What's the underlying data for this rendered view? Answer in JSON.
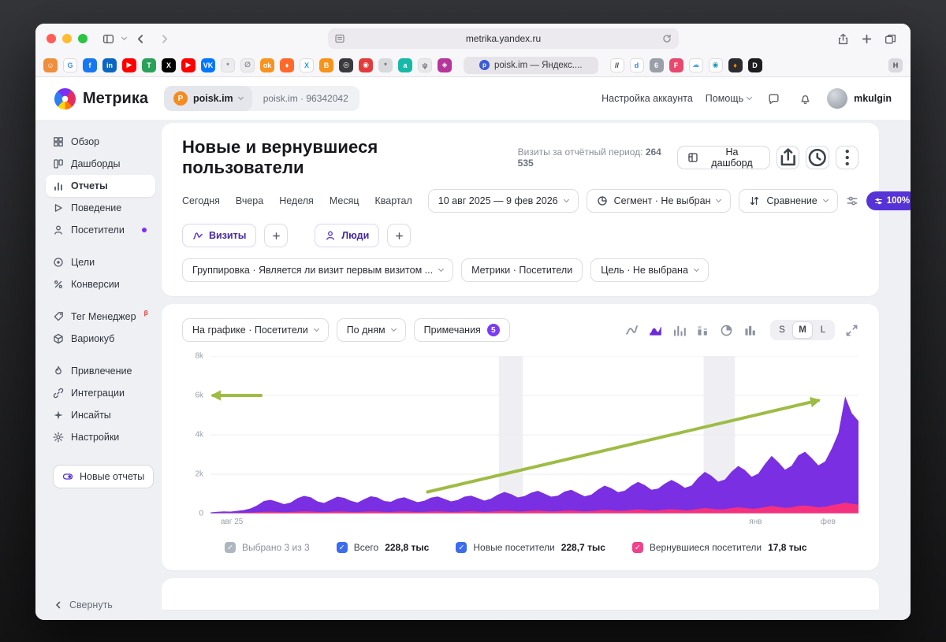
{
  "browser": {
    "url": "metrika.yandex.ru",
    "tab_title": "poisk.im — Яндекс....",
    "tab_favicon": "p",
    "bookmarks_left": [
      {
        "glyph": "☺",
        "bg": "#ef8e3b",
        "fg": "#ffffff"
      },
      {
        "glyph": "G",
        "bg": "#ffffff",
        "fg": "#4285f4",
        "border": true
      },
      {
        "glyph": "f",
        "bg": "#1877f2",
        "fg": "#ffffff"
      },
      {
        "glyph": "in",
        "bg": "#0a66c2",
        "fg": "#ffffff"
      },
      {
        "glyph": "▶",
        "bg": "#ff0000",
        "fg": "#ffffff"
      },
      {
        "glyph": "T",
        "bg": "#2aa159",
        "fg": "#ffffff"
      },
      {
        "glyph": "X",
        "bg": "#000000",
        "fg": "#ffffff"
      },
      {
        "glyph": "▶",
        "bg": "#ff0000",
        "fg": "#ffffff"
      },
      {
        "glyph": "VK",
        "bg": "#0077ff",
        "fg": "#ffffff"
      },
      {
        "glyph": "*",
        "bg": "#ececee",
        "fg": "#7b7b82",
        "border": true
      },
      {
        "glyph": "∅",
        "bg": "#ececee",
        "fg": "#7b7b82",
        "border": true
      },
      {
        "glyph": "ok",
        "bg": "#f7931e",
        "fg": "#ffffff"
      },
      {
        "glyph": "♦",
        "bg": "#ff6a2b",
        "fg": "#ffffff"
      },
      {
        "glyph": "X",
        "bg": "#ffffff",
        "fg": "#1d9bf0",
        "border": true
      },
      {
        "glyph": "B",
        "bg": "#f7931a",
        "fg": "#ffffff"
      },
      {
        "glyph": "◎",
        "bg": "#3a3a3e",
        "fg": "#ffffff"
      },
      {
        "glyph": "◉",
        "bg": "#e23b3b",
        "fg": "#ffffff"
      },
      {
        "glyph": "*",
        "bg": "#d7d9dd",
        "fg": "#606067"
      },
      {
        "glyph": "a",
        "bg": "#16b8a8",
        "fg": "#ffffff"
      },
      {
        "glyph": "ψ",
        "bg": "#e9e9ec",
        "fg": "#6a6a72",
        "border": true
      },
      {
        "glyph": "◈",
        "bg": "#b5359b",
        "fg": "#ffffff"
      }
    ],
    "bookmarks_right": [
      {
        "glyph": "//",
        "bg": "#ffffff",
        "fg": "#2b2b30",
        "border": true
      },
      {
        "glyph": "d",
        "bg": "#ffffff",
        "fg": "#2f7cf6",
        "border": true
      },
      {
        "glyph": "6",
        "bg": "#9a9fa8",
        "fg": "#ffffff"
      },
      {
        "glyph": "F",
        "bg": "#e8486e",
        "fg": "#ffffff"
      },
      {
        "glyph": "☁",
        "bg": "#ffffff",
        "fg": "#4aa3f5",
        "border": true
      },
      {
        "glyph": "◉",
        "bg": "#ffffff",
        "fg": "#189ab0",
        "border": true
      },
      {
        "glyph": "♦",
        "bg": "#2b2b30",
        "fg": "#ff8a00"
      },
      {
        "glyph": "D",
        "bg": "#1d1d20",
        "fg": "#ffffff"
      }
    ],
    "bookmarks_far_right": [
      {
        "glyph": "H",
        "bg": "#d9d9de",
        "fg": "#4a4a50"
      }
    ]
  },
  "header": {
    "brand": "Метрика",
    "counter_badge": "P",
    "counter_name": "poisk.im",
    "counter_meta": "poisk.im  ·  96342042",
    "account": "Настройка аккаунта",
    "help": "Помощь",
    "user": "mkulgin"
  },
  "sidebar": {
    "groups": [
      {
        "items": [
          {
            "key": "overview",
            "label": "Обзор",
            "icon": "grid"
          },
          {
            "key": "dashboards",
            "label": "Дашборды",
            "icon": "dashboards"
          },
          {
            "key": "reports",
            "label": "Отчеты",
            "icon": "reports",
            "active": true
          },
          {
            "key": "behavior",
            "label": "Поведение",
            "icon": "behavior"
          },
          {
            "key": "visitors",
            "label": "Посетители",
            "icon": "person",
            "dot": true
          }
        ]
      },
      {
        "items": [
          {
            "key": "goals",
            "label": "Цели",
            "icon": "goals"
          },
          {
            "key": "conversions",
            "label": "Конверсии",
            "icon": "conversions"
          }
        ]
      },
      {
        "items": [
          {
            "key": "tag-manager",
            "label": "Тег Менеджер",
            "icon": "tag",
            "badge": "β"
          },
          {
            "key": "variocube",
            "label": "Вариокуб",
            "icon": "cube"
          }
        ]
      },
      {
        "items": [
          {
            "key": "acquisition",
            "label": "Привлечение",
            "icon": "flame"
          },
          {
            "key": "integrations",
            "label": "Интеграции",
            "icon": "integrations"
          },
          {
            "key": "insights",
            "label": "Инсайты",
            "icon": "insights"
          },
          {
            "key": "settings",
            "label": "Настройки",
            "icon": "settings"
          }
        ]
      }
    ],
    "new_reports": "Новые отчеты",
    "collapse": "Свернуть"
  },
  "report": {
    "title": "Новые и вернувшиеся пользователи",
    "visits_label": "Визиты за отчётный период:",
    "visits_value": "264 535",
    "to_dashboard": "На дашборд",
    "periods": [
      {
        "key": "today",
        "label": "Сегодня"
      },
      {
        "key": "yesterday",
        "label": "Вчера"
      },
      {
        "key": "week",
        "label": "Неделя"
      },
      {
        "key": "month",
        "label": "Месяц"
      },
      {
        "key": "quarter",
        "label": "Квартал"
      }
    ],
    "date_range": "10 авг 2025 — 9 фев 2026",
    "segment": "Сегмент · Не выбран",
    "compare": "Сравнение",
    "sampling": "100%",
    "chip_visits": "Визиты",
    "chip_people": "Люди",
    "grouping": "Группировка · Является ли визит первым визитом ...",
    "metrics": "Метрики · Посетители",
    "goal": "Цель · Не выбрана"
  },
  "chart_card": {
    "on_chart": "На графике · Посетители",
    "granularity": "По дням",
    "notes": "Примечания",
    "notes_count": "5",
    "sizes": [
      "S",
      "M",
      "L"
    ],
    "size_active": "M"
  },
  "chart_data": {
    "type": "area",
    "title": "Новые и вернувшиеся пользователи — посетители по дням",
    "ylim": [
      0,
      8000
    ],
    "yticks": [
      {
        "label": "8k",
        "frac": 0
      },
      {
        "label": "6k",
        "frac": 0.25
      },
      {
        "label": "4k",
        "frac": 0.5
      },
      {
        "label": "2k",
        "frac": 0.75
      },
      {
        "label": "0",
        "frac": 1
      }
    ],
    "xticks": [
      {
        "label": "авг 25",
        "pos": 0.033
      },
      {
        "label": "янв",
        "pos": 0.841
      },
      {
        "label": "фев",
        "pos": 0.953
      }
    ],
    "series": [
      {
        "name": "Новые посетители",
        "color": "#7a2fe2",
        "values": [
          60,
          90,
          110,
          100,
          140,
          180,
          260,
          420,
          640,
          700,
          600,
          480,
          560,
          780,
          900,
          830,
          620,
          540,
          700,
          860,
          800,
          650,
          560,
          730,
          880,
          820,
          640,
          600,
          760,
          830,
          700,
          580,
          650,
          810,
          870,
          750,
          620,
          690,
          860,
          910,
          790,
          660,
          760,
          960,
          1100,
          990,
          820,
          890,
          1060,
          1160,
          1010,
          860,
          910,
          1120,
          1210,
          1040,
          880,
          960,
          1220,
          1420,
          1290,
          1090,
          1160,
          1420,
          1610,
          1450,
          1210,
          1270,
          1520,
          1710,
          1540,
          1310,
          1420,
          1820,
          2120,
          1920,
          1620,
          1730,
          2130,
          2420,
          2210,
          1870,
          2030,
          2520,
          2930,
          2610,
          2230,
          2430,
          2960,
          3140,
          2820,
          2450,
          2650,
          3300,
          4100,
          5950,
          5100,
          4700
        ]
      },
      {
        "name": "Вернувшиеся посетители",
        "color": "#f5317f",
        "values": [
          20,
          25,
          30,
          28,
          35,
          40,
          50,
          70,
          90,
          95,
          85,
          70,
          80,
          100,
          115,
          105,
          85,
          75,
          95,
          110,
          100,
          85,
          75,
          95,
          115,
          105,
          85,
          80,
          100,
          110,
          95,
          75,
          85,
          105,
          115,
          100,
          80,
          90,
          110,
          120,
          100,
          85,
          100,
          125,
          145,
          130,
          105,
          115,
          140,
          155,
          130,
          110,
          120,
          150,
          160,
          135,
          115,
          125,
          160,
          185,
          170,
          140,
          150,
          185,
          210,
          190,
          155,
          165,
          200,
          225,
          200,
          170,
          185,
          240,
          280,
          250,
          210,
          225,
          280,
          320,
          290,
          245,
          265,
          330,
          385,
          340,
          290,
          315,
          390,
          410,
          370,
          320,
          345,
          430,
          480,
          560,
          500,
          460
        ]
      }
    ],
    "bands": [
      {
        "from": 0.445,
        "to": 0.482
      },
      {
        "from": 0.761,
        "to": 0.809
      }
    ],
    "annotation_color": "#9ebc44",
    "annotations": [
      {
        "x1": 0.078,
        "y1": 6000,
        "x2": 0.004,
        "y2": 6000
      },
      {
        "x1": 0.335,
        "y1": 1100,
        "x2": 0.938,
        "y2": 5750
      }
    ],
    "legend": [
      {
        "key": "selected",
        "label": "Выбрано 3 из 3",
        "value": "",
        "checked": true,
        "color": "#aeb6c2",
        "muted": true
      },
      {
        "key": "total",
        "label": "Всего",
        "value": "228,8 тыс",
        "checked": true,
        "color": "#3b6cf0"
      },
      {
        "key": "new-visitors",
        "label": "Новые посетители",
        "value": "228,7 тыс",
        "checked": true,
        "color": "#3b6cf0"
      },
      {
        "key": "returning-visitors",
        "label": "Вернувшиеся посетители",
        "value": "17,8 тыс",
        "checked": true,
        "color": "#f0418c"
      }
    ]
  }
}
